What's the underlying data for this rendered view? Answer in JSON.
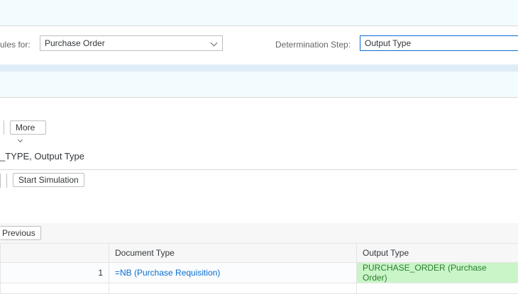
{
  "filter": {
    "rules_label": "ules for:",
    "document_select_value": "Purchase Order",
    "step_label": "Determination Step:",
    "step_input_value": "Output Type"
  },
  "toolbar": {
    "more_label": "More"
  },
  "section": {
    "title": "_TYPE, Output Type"
  },
  "simulation": {
    "start_label": "Start Simulation"
  },
  "table": {
    "previous_label": "Previous",
    "headers": [
      "",
      "Document Type",
      "Output Type"
    ],
    "rows": [
      {
        "index": "1",
        "document_type": "=NB (Purchase Requisition)",
        "output_type": "PURCHASE_ORDER (Purchase Order)"
      }
    ]
  },
  "colors": {
    "accent": "#0a6ed1",
    "success_bg": "#c9f5c9",
    "success_text": "#2b7d2b"
  }
}
